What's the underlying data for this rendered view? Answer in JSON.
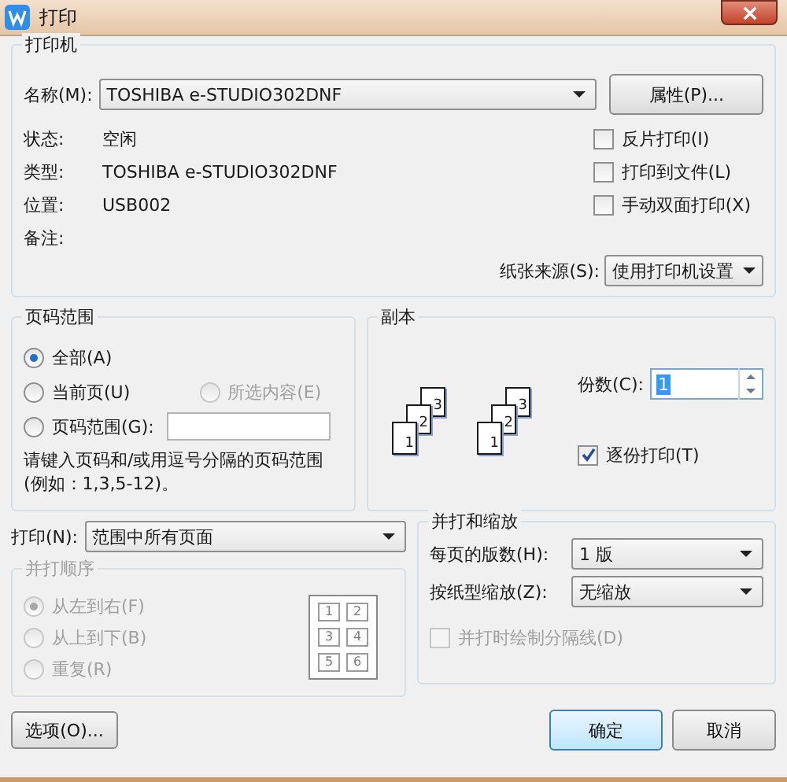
{
  "window": {
    "title": "打印"
  },
  "printer": {
    "title": "打印机",
    "name_label": "名称(M):",
    "name_value": "TOSHIBA e-STUDIO302DNF",
    "properties_button": "属性(P)...",
    "info": [
      {
        "label": "状态:",
        "value": "空闲"
      },
      {
        "label": "类型:",
        "value": "TOSHIBA e-STUDIO302DNF"
      },
      {
        "label": "位置:",
        "value": "USB002"
      },
      {
        "label": "备注:"
      }
    ],
    "options": [
      {
        "label": "反片打印(I)",
        "checked": false
      },
      {
        "label": "打印到文件(L)",
        "checked": false
      },
      {
        "label": "手动双面打印(X)",
        "checked": false
      }
    ],
    "paper_source_label": "纸张来源(S):",
    "paper_source_value": "使用打印机设置"
  },
  "page_range": {
    "title": "页码范围",
    "rows": [
      [
        {
          "label": "全部(A)",
          "selected": true,
          "disabled": false
        }
      ],
      [
        {
          "label": "当前页(U)",
          "selected": false,
          "disabled": false
        },
        {
          "label": "所选内容(E)",
          "selected": false,
          "disabled": true
        }
      ],
      [
        {
          "label": "页码范围(G):",
          "selected": false,
          "disabled": false,
          "kind": "input"
        }
      ]
    ],
    "hint": "请键入页码和/或用逗号分隔的页码范围(例如：1,3,5-12)。"
  },
  "copies": {
    "title": "副本",
    "stacks": [
      [
        "1",
        "2",
        "3"
      ],
      [
        "1",
        "2",
        "3"
      ]
    ],
    "count_label": "份数(C):",
    "count_value": "1",
    "collate": {
      "label": "逐份打印(T)",
      "checked": true
    }
  },
  "print_label": "打印(N):",
  "print_value": "范围中所有页面",
  "order": {
    "title": "并打顺序",
    "disabled": true,
    "options": [
      {
        "label": "从左到右(F)",
        "selected": true
      },
      {
        "label": "从上到下(B)",
        "selected": false
      },
      {
        "label": "重复(R)",
        "selected": false
      }
    ],
    "preview": [
      "1",
      "2",
      "3",
      "4",
      "5",
      "6"
    ]
  },
  "scaling": {
    "title": "并打和缩放",
    "fields": [
      {
        "label": "每页的版数(H):",
        "value": "1 版"
      },
      {
        "label": "按纸型缩放(Z):",
        "value": "无缩放"
      }
    ],
    "divider_option": {
      "label": "并打时绘制分隔线(D)",
      "checked": false,
      "disabled": true
    }
  },
  "buttons": {
    "options": "选项(O)...",
    "ok": "确定",
    "cancel": "取消"
  }
}
